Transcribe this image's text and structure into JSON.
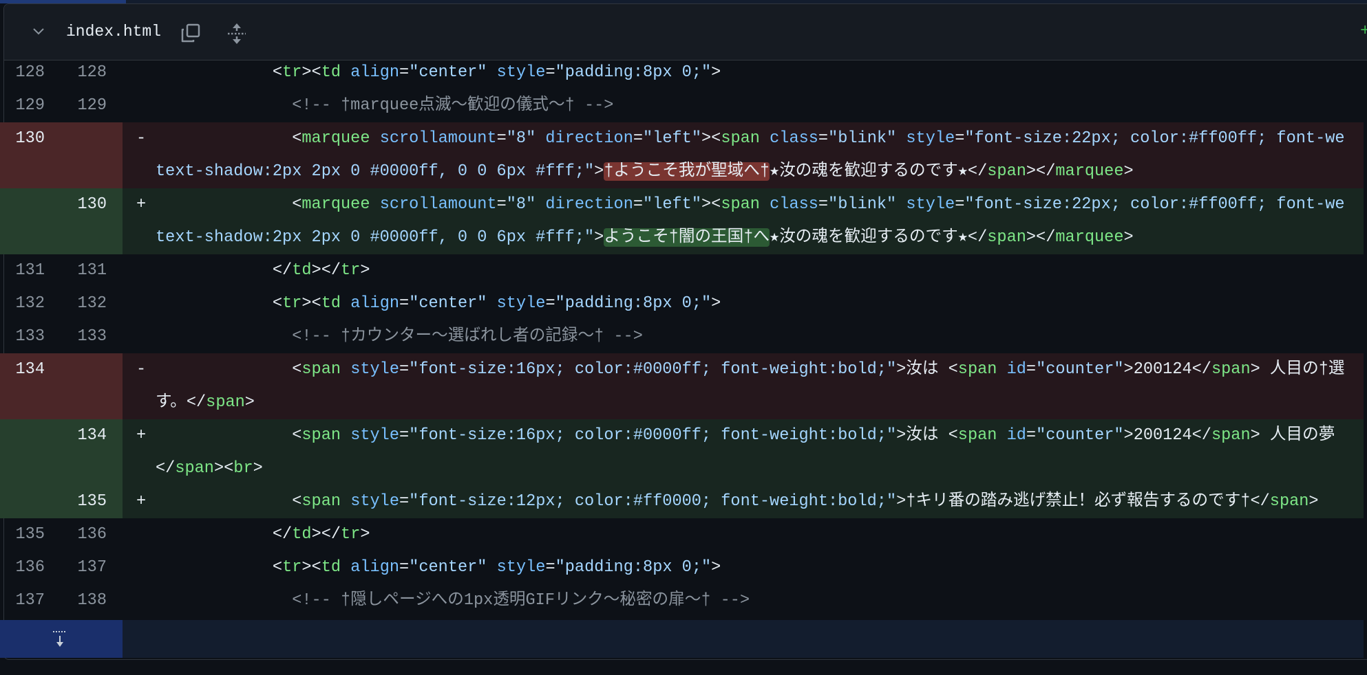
{
  "file": {
    "name": "index.html",
    "added_indicator": "+"
  },
  "icons": {
    "collapse": "chevron-down-icon",
    "copy": "copy-icon",
    "expand": "unfold-icon",
    "expand_down": "expand-down-icon"
  },
  "colors": {
    "tag": "#7ee787",
    "attr": "#79c0ff",
    "string": "#a5d6ff",
    "comment": "#8b949e",
    "deletion": "#25171c",
    "addition": "#182620"
  },
  "rows": [
    {
      "type": "ctx",
      "old": "128",
      "new": "128",
      "sign": "",
      "lines": [
        [
          [
            "p",
            "            <"
          ],
          [
            "t",
            "tr"
          ],
          [
            "p",
            "><"
          ],
          [
            "t",
            "td"
          ],
          [
            "p",
            " "
          ],
          [
            "a",
            "align"
          ],
          [
            "p",
            "="
          ],
          [
            "s",
            "\"center\""
          ],
          [
            "p",
            " "
          ],
          [
            "a",
            "style"
          ],
          [
            "p",
            "="
          ],
          [
            "s",
            "\"padding:8px 0;\""
          ],
          [
            "p",
            ">"
          ]
        ]
      ]
    },
    {
      "type": "ctx",
      "old": "129",
      "new": "129",
      "sign": "",
      "lines": [
        [
          [
            "c",
            "              <!-- †marquee点滅～歓迎の儀式～† -->"
          ]
        ]
      ]
    },
    {
      "type": "del",
      "old": "130",
      "new": "",
      "sign": "-",
      "lines": [
        [
          [
            "p",
            "              <"
          ],
          [
            "t",
            "marquee"
          ],
          [
            "p",
            " "
          ],
          [
            "a",
            "scrollamount"
          ],
          [
            "p",
            "="
          ],
          [
            "s",
            "\"8\""
          ],
          [
            "p",
            " "
          ],
          [
            "a",
            "direction"
          ],
          [
            "p",
            "="
          ],
          [
            "s",
            "\"left\""
          ],
          [
            "p",
            "><"
          ],
          [
            "t",
            "span"
          ],
          [
            "p",
            " "
          ],
          [
            "a",
            "class"
          ],
          [
            "p",
            "="
          ],
          [
            "s",
            "\"blink\""
          ],
          [
            "p",
            " "
          ],
          [
            "a",
            "style"
          ],
          [
            "p",
            "="
          ],
          [
            "s",
            "\"font-size:22px; color:#ff00ff; font-we"
          ]
        ],
        [
          [
            "s",
            "text-shadow:2px 2px 0 #0000ff, 0 0 6px #fff;\""
          ],
          [
            "p",
            ">"
          ],
          [
            "hd",
            "†ようこそ我が聖域へ†"
          ],
          [
            "p",
            "★汝の魂を歓迎するのです★</"
          ],
          [
            "t",
            "span"
          ],
          [
            "p",
            "></"
          ],
          [
            "t",
            "marquee"
          ],
          [
            "p",
            ">"
          ]
        ]
      ]
    },
    {
      "type": "add",
      "old": "",
      "new": "130",
      "sign": "+",
      "lines": [
        [
          [
            "p",
            "              <"
          ],
          [
            "t",
            "marquee"
          ],
          [
            "p",
            " "
          ],
          [
            "a",
            "scrollamount"
          ],
          [
            "p",
            "="
          ],
          [
            "s",
            "\"8\""
          ],
          [
            "p",
            " "
          ],
          [
            "a",
            "direction"
          ],
          [
            "p",
            "="
          ],
          [
            "s",
            "\"left\""
          ],
          [
            "p",
            "><"
          ],
          [
            "t",
            "span"
          ],
          [
            "p",
            " "
          ],
          [
            "a",
            "class"
          ],
          [
            "p",
            "="
          ],
          [
            "s",
            "\"blink\""
          ],
          [
            "p",
            " "
          ],
          [
            "a",
            "style"
          ],
          [
            "p",
            "="
          ],
          [
            "s",
            "\"font-size:22px; color:#ff00ff; font-we"
          ]
        ],
        [
          [
            "s",
            "text-shadow:2px 2px 0 #0000ff, 0 0 6px #fff;\""
          ],
          [
            "p",
            ">"
          ],
          [
            "ha",
            "ようこそ†闇の王国†へ"
          ],
          [
            "p",
            "★汝の魂を歓迎するのです★</"
          ],
          [
            "t",
            "span"
          ],
          [
            "p",
            "></"
          ],
          [
            "t",
            "marquee"
          ],
          [
            "p",
            ">"
          ]
        ]
      ]
    },
    {
      "type": "ctx",
      "old": "131",
      "new": "131",
      "sign": "",
      "lines": [
        [
          [
            "p",
            "            </"
          ],
          [
            "t",
            "td"
          ],
          [
            "p",
            "></"
          ],
          [
            "t",
            "tr"
          ],
          [
            "p",
            ">"
          ]
        ]
      ]
    },
    {
      "type": "ctx",
      "old": "132",
      "new": "132",
      "sign": "",
      "lines": [
        [
          [
            "p",
            "            <"
          ],
          [
            "t",
            "tr"
          ],
          [
            "p",
            "><"
          ],
          [
            "t",
            "td"
          ],
          [
            "p",
            " "
          ],
          [
            "a",
            "align"
          ],
          [
            "p",
            "="
          ],
          [
            "s",
            "\"center\""
          ],
          [
            "p",
            " "
          ],
          [
            "a",
            "style"
          ],
          [
            "p",
            "="
          ],
          [
            "s",
            "\"padding:8px 0;\""
          ],
          [
            "p",
            ">"
          ]
        ]
      ]
    },
    {
      "type": "ctx",
      "old": "133",
      "new": "133",
      "sign": "",
      "lines": [
        [
          [
            "c",
            "              <!-- †カウンター～選ばれし者の記録～† -->"
          ]
        ]
      ]
    },
    {
      "type": "del",
      "old": "134",
      "new": "",
      "sign": "-",
      "lines": [
        [
          [
            "p",
            "              <"
          ],
          [
            "t",
            "span"
          ],
          [
            "p",
            " "
          ],
          [
            "a",
            "style"
          ],
          [
            "p",
            "="
          ],
          [
            "s",
            "\"font-size:16px; color:#0000ff; font-weight:bold;\""
          ],
          [
            "p",
            ">汝は <"
          ],
          [
            "t",
            "span"
          ],
          [
            "p",
            " "
          ],
          [
            "a",
            "id"
          ],
          [
            "p",
            "="
          ],
          [
            "s",
            "\"counter\""
          ],
          [
            "p",
            ">200124</"
          ],
          [
            "t",
            "span"
          ],
          [
            "p",
            "> 人目の†選"
          ]
        ],
        [
          [
            "p",
            "す。</"
          ],
          [
            "t",
            "span"
          ],
          [
            "p",
            ">"
          ]
        ]
      ]
    },
    {
      "type": "add",
      "old": "",
      "new": "134",
      "sign": "+",
      "lines": [
        [
          [
            "p",
            "              <"
          ],
          [
            "t",
            "span"
          ],
          [
            "p",
            " "
          ],
          [
            "a",
            "style"
          ],
          [
            "p",
            "="
          ],
          [
            "s",
            "\"font-size:16px; color:#0000ff; font-weight:bold;\""
          ],
          [
            "p",
            ">汝は <"
          ],
          [
            "t",
            "span"
          ],
          [
            "p",
            " "
          ],
          [
            "a",
            "id"
          ],
          [
            "p",
            "="
          ],
          [
            "s",
            "\"counter\""
          ],
          [
            "p",
            ">200124</"
          ],
          [
            "t",
            "span"
          ],
          [
            "p",
            "> 人目の夢"
          ]
        ],
        [
          [
            "p",
            "</"
          ],
          [
            "t",
            "span"
          ],
          [
            "p",
            "><"
          ],
          [
            "t",
            "br"
          ],
          [
            "p",
            ">"
          ]
        ]
      ]
    },
    {
      "type": "add",
      "old": "",
      "new": "135",
      "sign": "+",
      "lines": [
        [
          [
            "p",
            "              <"
          ],
          [
            "t",
            "span"
          ],
          [
            "p",
            " "
          ],
          [
            "a",
            "style"
          ],
          [
            "p",
            "="
          ],
          [
            "s",
            "\"font-size:12px; color:#ff0000; font-weight:bold;\""
          ],
          [
            "p",
            ">†キリ番の踏み逃げ禁止！必ず報告するのです†</"
          ],
          [
            "t",
            "span"
          ],
          [
            "p",
            ">"
          ]
        ]
      ]
    },
    {
      "type": "ctx",
      "old": "135",
      "new": "136",
      "sign": "",
      "lines": [
        [
          [
            "p",
            "            </"
          ],
          [
            "t",
            "td"
          ],
          [
            "p",
            "></"
          ],
          [
            "t",
            "tr"
          ],
          [
            "p",
            ">"
          ]
        ]
      ]
    },
    {
      "type": "ctx",
      "old": "136",
      "new": "137",
      "sign": "",
      "lines": [
        [
          [
            "p",
            "            <"
          ],
          [
            "t",
            "tr"
          ],
          [
            "p",
            "><"
          ],
          [
            "t",
            "td"
          ],
          [
            "p",
            " "
          ],
          [
            "a",
            "align"
          ],
          [
            "p",
            "="
          ],
          [
            "s",
            "\"center\""
          ],
          [
            "p",
            " "
          ],
          [
            "a",
            "style"
          ],
          [
            "p",
            "="
          ],
          [
            "s",
            "\"padding:8px 0;\""
          ],
          [
            "p",
            ">"
          ]
        ]
      ]
    },
    {
      "type": "ctx",
      "old": "137",
      "new": "138",
      "sign": "",
      "lines": [
        [
          [
            "c",
            "              <!-- †隠しページへの1px透明GIFリンク～秘密の扉～† -->"
          ]
        ]
      ]
    }
  ]
}
